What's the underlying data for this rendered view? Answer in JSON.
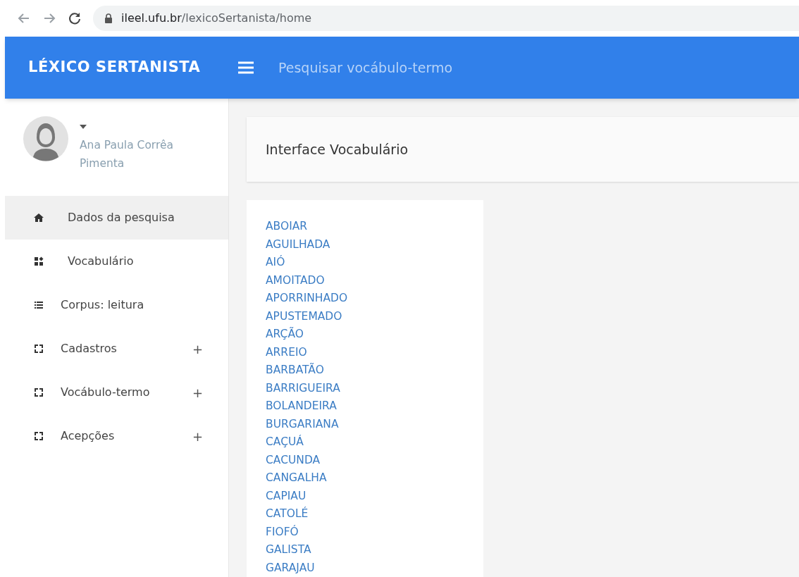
{
  "browser": {
    "url_host": "ileel.ufu.br",
    "url_path": "/lexicoSertanista/home"
  },
  "header": {
    "brand": "LÉXICO SERTANISTA",
    "search_link": "Pesquisar vocábulo-termo"
  },
  "user": {
    "name": "Ana Paula Corrêa Pimenta"
  },
  "sidebar": {
    "items": [
      {
        "label": "Dados da pesquisa",
        "kind": "home",
        "selected": true
      },
      {
        "label": "Vocabulário",
        "kind": "grid",
        "selected": false
      },
      {
        "label": "Corpus: leitura",
        "kind": "list",
        "selected": false
      },
      {
        "label": "Cadastros",
        "kind": "expand",
        "selected": false,
        "toggle": "+"
      },
      {
        "label": "Vocábulo-termo",
        "kind": "expand",
        "selected": false,
        "toggle": "+"
      },
      {
        "label": "Acepções",
        "kind": "expand",
        "selected": false,
        "toggle": "+"
      }
    ]
  },
  "page_title": "Interface Vocabulário",
  "words": [
    "ABOIAR",
    "AGUILHADA",
    "AIÓ",
    "AMOITADO",
    "APORRINHADO",
    "APUSTEMADO",
    "ARÇÃO",
    "ARREIO",
    "BARBATÃO",
    "BARRIGUEIRA",
    "BOLANDEIRA",
    "BURGARIANA",
    "CAÇUÁ",
    "CACUNDA",
    "CANGALHA",
    "CAPIAU",
    "CATOLÉ",
    "FIOFÓ",
    "GALISTA",
    "GARAJAU"
  ]
}
